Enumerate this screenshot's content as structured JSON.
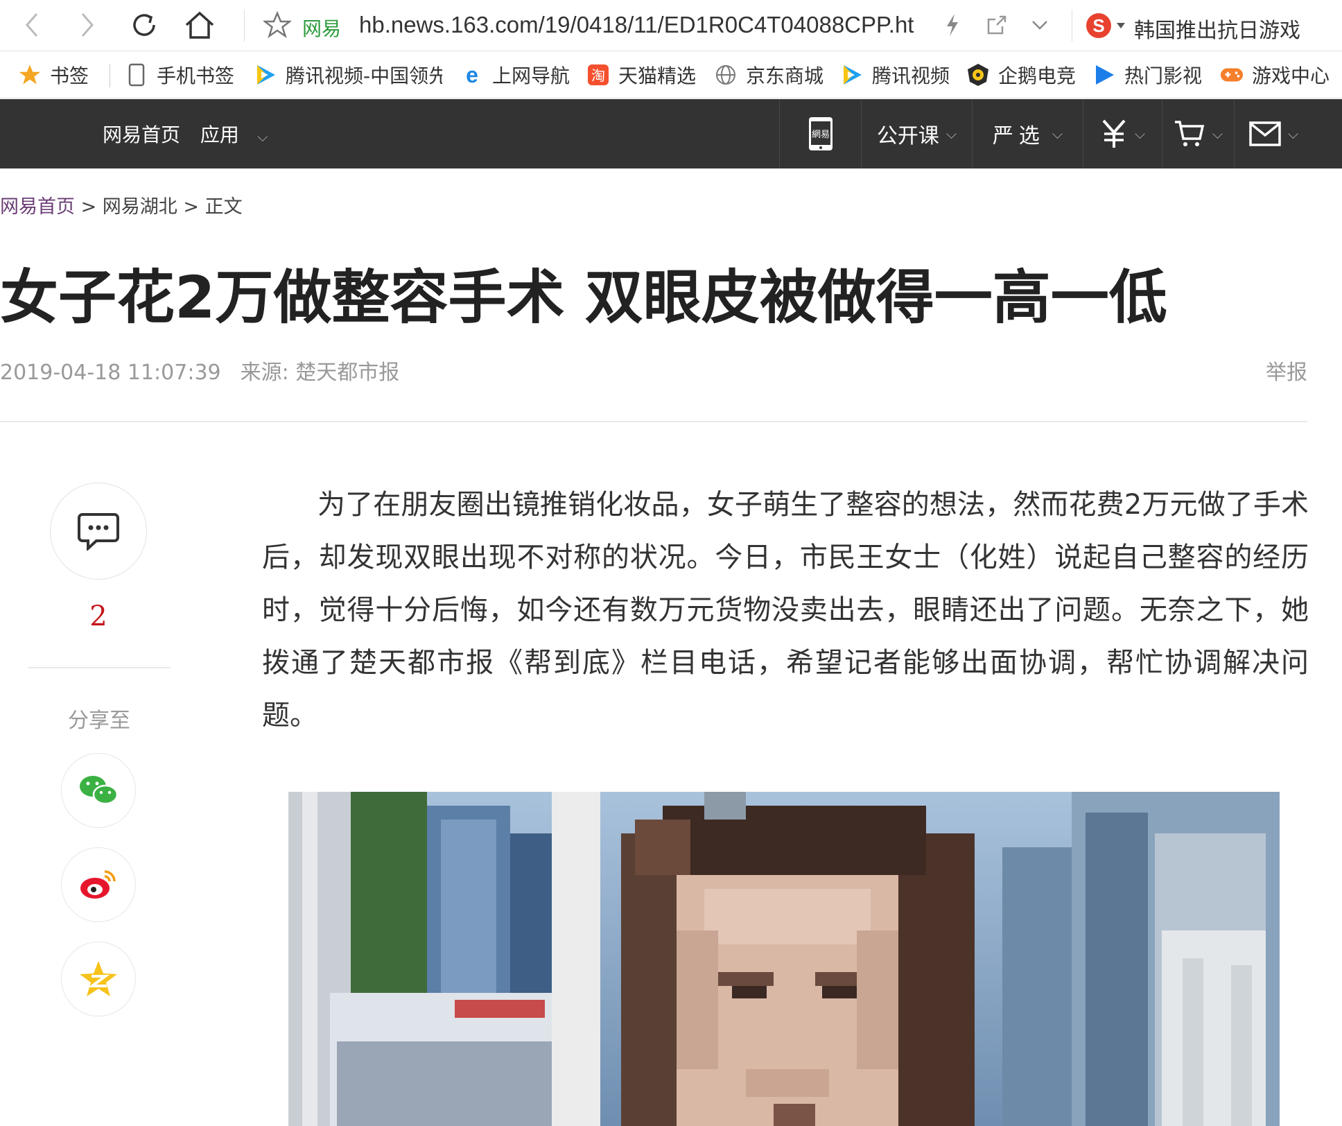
{
  "browser": {
    "site_tag": "网易",
    "url": "hb.news.163.com/19/0418/11/ED1R0C4T04088CPP.ht",
    "search_text": "韩国推出抗日游戏"
  },
  "bookmarks": [
    {
      "label": "书签",
      "icon": "star-icon"
    },
    {
      "label": "手机书签",
      "icon": "phone-icon"
    },
    {
      "label": "腾讯视频-中国领先",
      "icon": "tencent-video-icon"
    },
    {
      "label": "上网导航",
      "icon": "ie-icon"
    },
    {
      "label": "天猫精选",
      "icon": "tmall-icon"
    },
    {
      "label": "京东商城",
      "icon": "globe-icon"
    },
    {
      "label": "腾讯视频",
      "icon": "tencent-video-icon"
    },
    {
      "label": "企鹅电竞",
      "icon": "penguin-esports-icon"
    },
    {
      "label": "热门影视",
      "icon": "play-icon"
    },
    {
      "label": "游戏中心",
      "icon": "gamepad-icon"
    }
  ],
  "site_nav": {
    "home": "网易首页",
    "apps": "应用",
    "open_course": "公开课",
    "yanxuan": "严选"
  },
  "article": {
    "breadcrumb": {
      "home": "网易首页",
      "sep1": " > ",
      "region": "网易湖北",
      "sep2": " > ",
      "current": "正文"
    },
    "title": "女子花2万做整容手术 双眼皮被做得一高一低",
    "date": "2019-04-18 11:07:39",
    "source": "来源: 楚天都市报",
    "report": "举报",
    "paragraph": "为了在朋友圈出镜推销化妆品，女子萌生了整容的想法，然而花费2万元做了手术后，却发现双眼出现不对称的状况。今日，市民王女士（化姓）说起自己整容的经历时，觉得十分后悔，如今还有数万元货物没卖出去，眼睛还出了问题。无奈之下，她拨通了楚天都市报《帮到底》栏目电话，希望记者能够出面协调，帮忙协调解决问题。"
  },
  "sidebar": {
    "comment_count": "2",
    "share_label": "分享至",
    "share_targets": [
      "wechat-icon",
      "weibo-icon",
      "qzone-icon"
    ]
  }
}
